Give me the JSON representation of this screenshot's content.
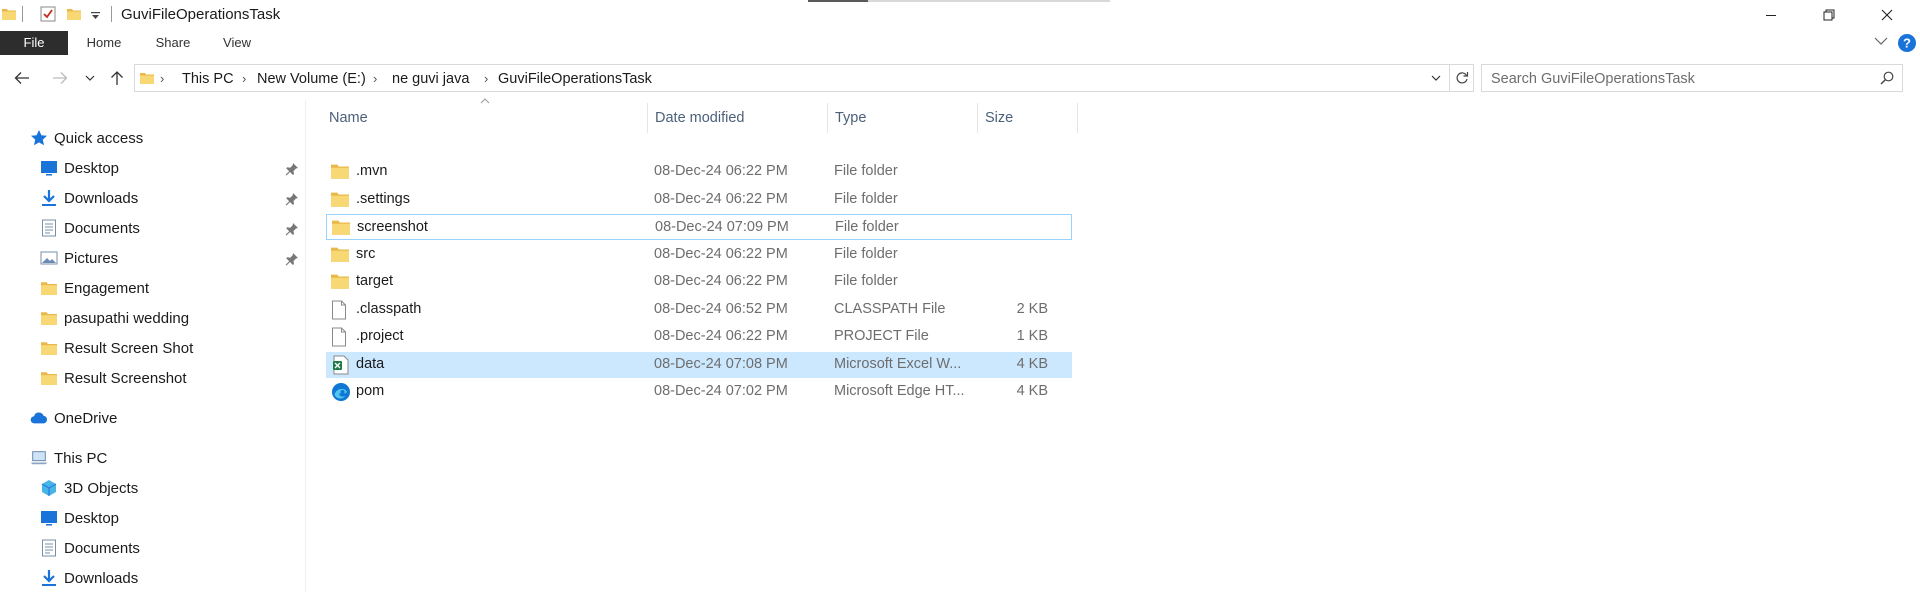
{
  "window": {
    "title": "GuviFileOperationsTask"
  },
  "ribbon": {
    "tabs": [
      "File",
      "Home",
      "Share",
      "View"
    ]
  },
  "address": {
    "breadcrumbs": [
      "This PC",
      "New Volume (E:)",
      "ne guvi java",
      "GuviFileOperationsTask"
    ]
  },
  "search": {
    "placeholder": "Search GuviFileOperationsTask"
  },
  "nav": {
    "quick_access": "Quick access",
    "quick_items": [
      {
        "label": "Desktop",
        "icon": "desktop-icon",
        "pinned": true
      },
      {
        "label": "Downloads",
        "icon": "download-icon",
        "pinned": true
      },
      {
        "label": "Documents",
        "icon": "documents-icon",
        "pinned": true
      },
      {
        "label": "Pictures",
        "icon": "pictures-icon",
        "pinned": true
      },
      {
        "label": "Engagement",
        "icon": "folder-icon",
        "pinned": false
      },
      {
        "label": "pasupathi wedding",
        "icon": "folder-icon",
        "pinned": false
      },
      {
        "label": "Result Screen Shot",
        "icon": "folder-icon",
        "pinned": false
      },
      {
        "label": "Result Screenshot",
        "icon": "folder-icon",
        "pinned": false
      }
    ],
    "onedrive": "OneDrive",
    "this_pc": "This PC",
    "pc_items": [
      {
        "label": "3D Objects",
        "icon": "3d-objects-icon"
      },
      {
        "label": "Desktop",
        "icon": "desktop-icon"
      },
      {
        "label": "Documents",
        "icon": "documents-icon"
      },
      {
        "label": "Downloads",
        "icon": "download-icon"
      }
    ]
  },
  "columns": {
    "name": "Name",
    "date": "Date modified",
    "type": "Type",
    "size": "Size"
  },
  "files": [
    {
      "name": ".mvn",
      "date": "08-Dec-24 06:22 PM",
      "type": "File folder",
      "size": "",
      "icon": "folder-icon"
    },
    {
      "name": ".settings",
      "date": "08-Dec-24 06:22 PM",
      "type": "File folder",
      "size": "",
      "icon": "folder-icon"
    },
    {
      "name": "screenshot",
      "date": "08-Dec-24 07:09 PM",
      "type": "File folder",
      "size": "",
      "icon": "folder-icon",
      "state": "focused"
    },
    {
      "name": "src",
      "date": "08-Dec-24 06:22 PM",
      "type": "File folder",
      "size": "",
      "icon": "folder-icon"
    },
    {
      "name": "target",
      "date": "08-Dec-24 06:22 PM",
      "type": "File folder",
      "size": "",
      "icon": "folder-icon"
    },
    {
      "name": ".classpath",
      "date": "08-Dec-24 06:52 PM",
      "type": "CLASSPATH File",
      "size": "2 KB",
      "icon": "file-icon"
    },
    {
      "name": ".project",
      "date": "08-Dec-24 06:22 PM",
      "type": "PROJECT File",
      "size": "1 KB",
      "icon": "file-icon"
    },
    {
      "name": "data",
      "date": "08-Dec-24 07:08 PM",
      "type": "Microsoft Excel W...",
      "size": "4 KB",
      "icon": "excel-csv-icon",
      "state": "selected"
    },
    {
      "name": "pom",
      "date": "08-Dec-24 07:02 PM",
      "type": "Microsoft Edge HT...",
      "size": "4 KB",
      "icon": "edge-icon"
    }
  ],
  "colors": {
    "folder": "#f8d775",
    "selection": "#cce8ff",
    "focus": "#99d1ff",
    "accent": "#0078d7"
  }
}
